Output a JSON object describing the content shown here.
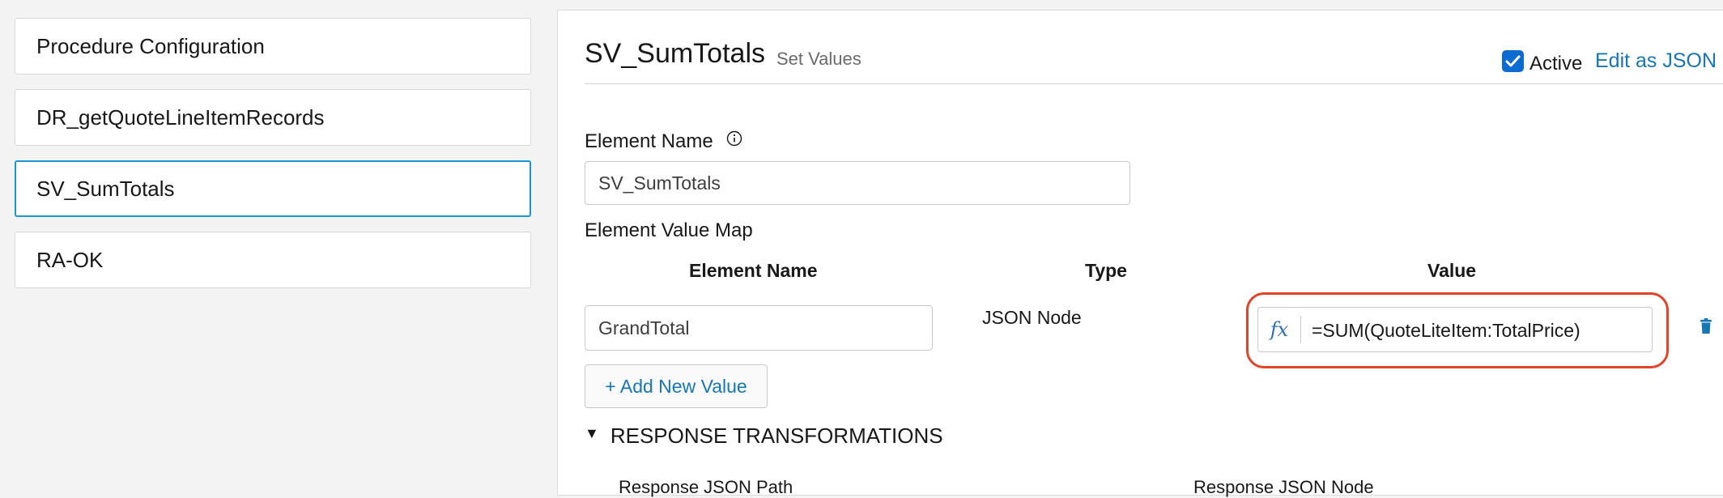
{
  "steps": [
    {
      "label": "Procedure Configuration"
    },
    {
      "label": "DR_getQuoteLineItemRecords"
    },
    {
      "label": "SV_SumTotals"
    },
    {
      "label": "RA-OK"
    }
  ],
  "header": {
    "title": "SV_SumTotals",
    "subtitle": "Set Values",
    "active_label": "Active",
    "active_checked": true,
    "edit_json_label": "Edit as JSON"
  },
  "form": {
    "element_name_label": "Element Name",
    "element_name_value": "SV_SumTotals",
    "value_map_label": "Element Value Map",
    "columns": {
      "name": "Element Name",
      "type": "Type",
      "value": "Value"
    },
    "rows": [
      {
        "name": "GrandTotal",
        "type": "JSON Node",
        "value": "=SUM(QuoteLiteItem:TotalPrice)"
      }
    ],
    "add_value_label": "+ Add New Value",
    "response_section_label": "RESPONSE TRANSFORMATIONS",
    "response_json_path_label": "Response JSON Path",
    "response_json_node_label": "Response JSON Node"
  },
  "colors": {
    "accent": "#1677b3",
    "selected_border": "#1b96d4",
    "highlight_ring": "#e0452a",
    "checkbox": "#0b6bd0"
  },
  "icons": {
    "info": "info-icon",
    "formula": "fx-icon",
    "delete": "trash-icon",
    "section_toggle": "triangle-down-icon",
    "check": "checkmark-icon"
  }
}
